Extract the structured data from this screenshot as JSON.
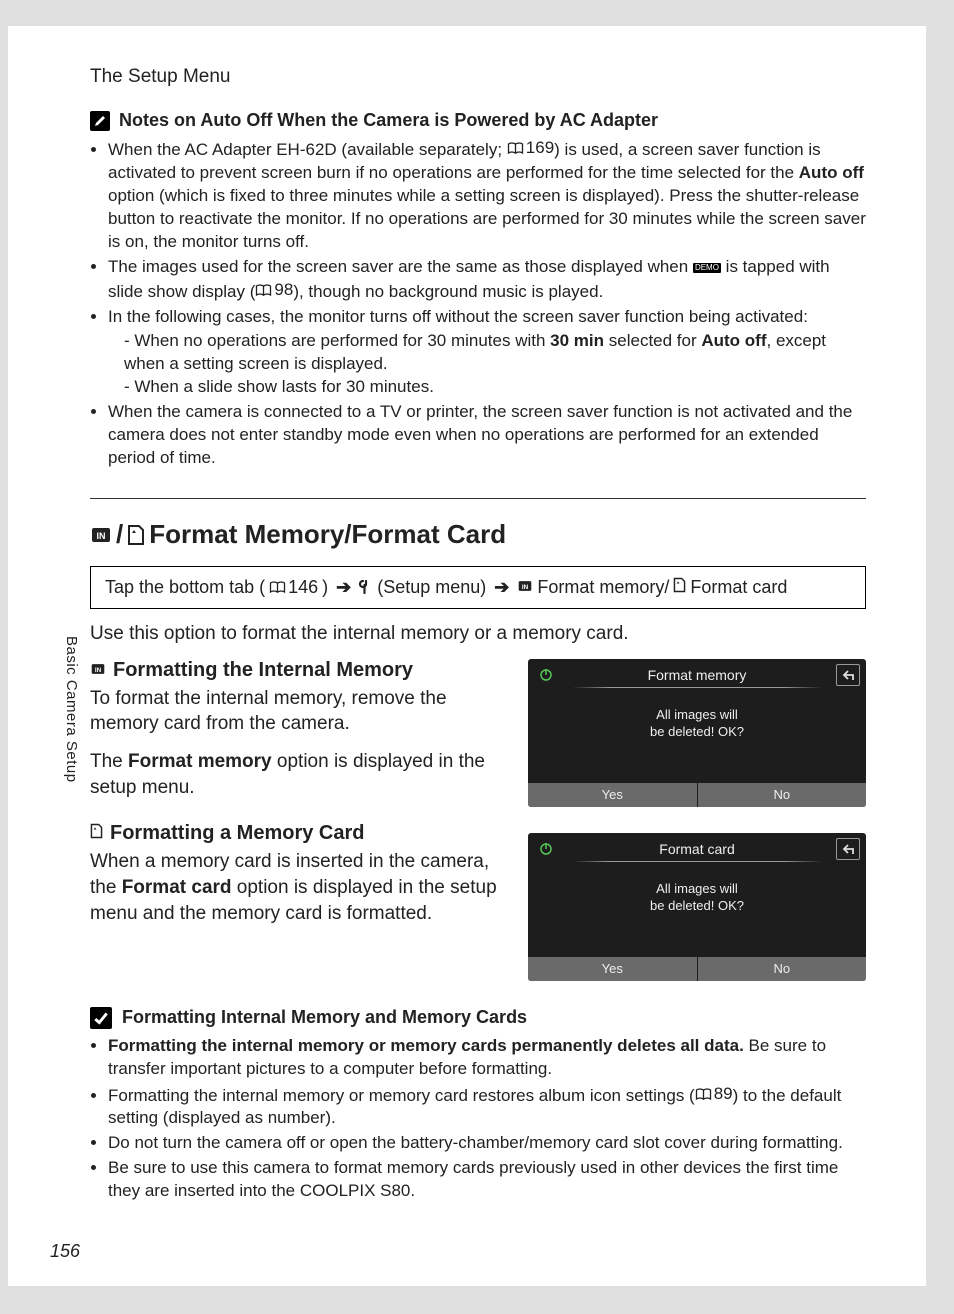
{
  "chapter": "The Setup Menu",
  "side_label": "Basic Camera Setup",
  "page_number": "156",
  "notes_auto_off": {
    "heading": "Notes on Auto Off When the Camera is Powered by AC Adapter",
    "b1_pre": "When the AC Adapter EH-62D (available separately; ",
    "b1_ref": "169",
    "b1_mid": ") is used, a screen saver function is activated to prevent screen burn if no operations are performed for the time selected for the ",
    "b1_bold": "Auto off",
    "b1_post": " option (which is fixed to three minutes while a setting screen is displayed). Press the shutter-release button to reactivate the monitor. If no operations are performed for 30 minutes while the screen saver is on, the monitor turns off.",
    "b2_pre": "The images used for the screen saver are the same as those displayed when ",
    "b2_demo": "DEMO",
    "b2_mid": " is tapped with slide show display (",
    "b2_ref": "98",
    "b2_post": "), though no background music is played.",
    "b3": "In the following cases, the monitor turns off without the screen saver function being activated:",
    "b3_s1_pre": "When no operations are performed for 30 minutes with ",
    "b3_s1_bold1": "30 min",
    "b3_s1_mid": " selected for ",
    "b3_s1_bold2": "Auto off",
    "b3_s1_post": ", except when a setting screen is displayed.",
    "b3_s2": "When a slide show lasts for 30 minutes.",
    "b4": "When the camera is connected to a TV or printer, the screen saver function is not activated and the camera does not enter standby mode even when no operations are performed for an extended period of time."
  },
  "format_section": {
    "title": "Format Memory/Format Card",
    "nav_pre": "Tap the bottom tab (",
    "nav_ref": "146",
    "nav_mid1": ")",
    "nav_setup": "(Setup menu)",
    "nav_fmt_mem": "Format memory/",
    "nav_fmt_card": "Format card",
    "intro": "Use this option to format the internal memory or a memory card.",
    "sub1_title": "Formatting the Internal Memory",
    "sub1_p1": "To format the internal memory, remove the memory card from the camera.",
    "sub1_p2_pre": "The ",
    "sub1_p2_bold": "Format memory",
    "sub1_p2_post": " option is displayed in the setup menu.",
    "sub2_title": "Formatting a Memory Card",
    "sub2_p_pre": "When a memory card is inserted in the camera, the ",
    "sub2_p_bold": "Format card",
    "sub2_p_post": " option is displayed in the setup menu and the memory card is formatted."
  },
  "cam1": {
    "title": "Format memory",
    "msg1": "All images will",
    "msg2": "be deleted! OK?",
    "yes": "Yes",
    "no": "No"
  },
  "cam2": {
    "title": "Format card",
    "msg1": "All images will",
    "msg2": "be deleted! OK?",
    "yes": "Yes",
    "no": "No"
  },
  "info_section": {
    "heading": "Formatting Internal Memory and Memory Cards",
    "b1_bold": "Formatting the internal memory or memory cards permanently deletes all data.",
    "b1_post": " Be sure to transfer important pictures to a computer before formatting.",
    "b2_pre": "Formatting the internal memory or memory card restores album icon settings (",
    "b2_ref": "89",
    "b2_post": ") to the default setting (displayed as number).",
    "b3": "Do not turn the camera off or open the battery-chamber/memory card slot cover during formatting.",
    "b4": "Be sure to use this camera to format memory cards previously used in other devices the first time they are inserted into the COOLPIX S80."
  }
}
